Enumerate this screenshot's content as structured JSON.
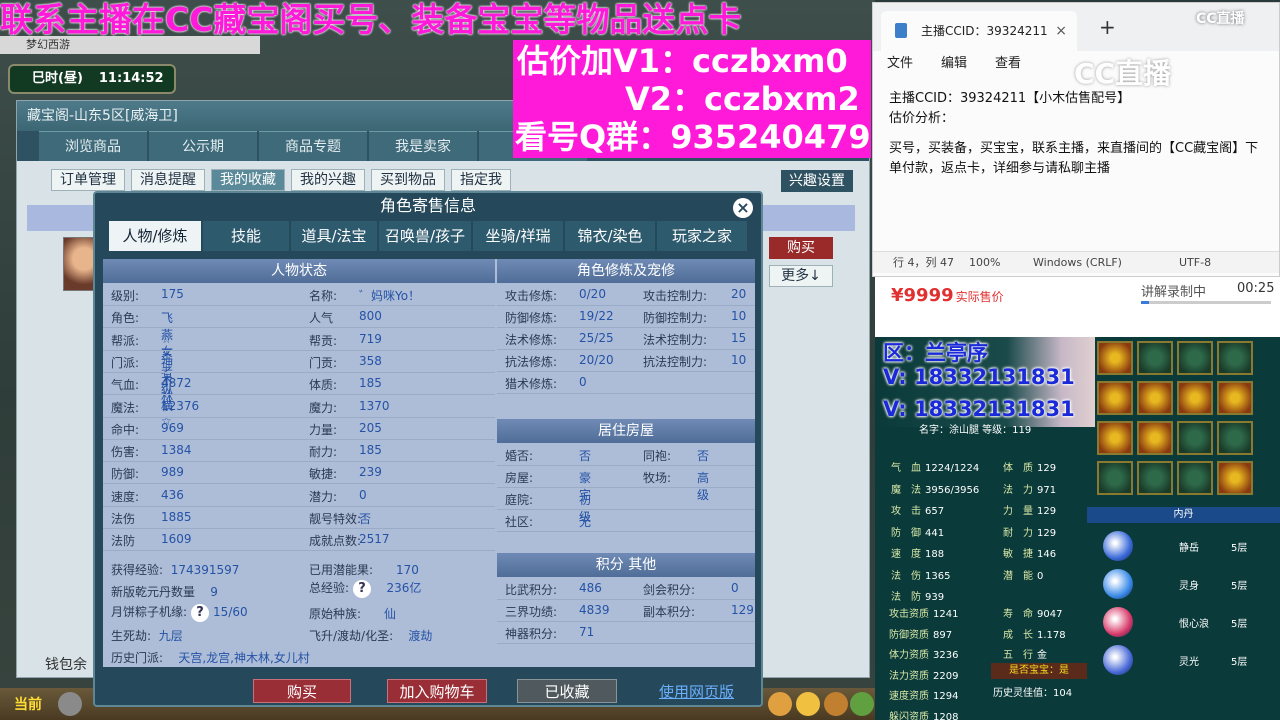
{
  "game": {
    "browser_tab_text": "梦幻西游",
    "clock_label": "巳时(昼)",
    "clock_time": "11:14:52",
    "window_title": "藏宝阁-山东5区[威海卫]",
    "nav_tabs": [
      "浏览商品",
      "公示期",
      "商品专题",
      "我是卖家",
      "我"
    ],
    "sub_tabs": [
      "订单管理",
      "消息提醒",
      "我的收藏",
      "我的兴趣",
      "买到物品",
      "指定我"
    ],
    "interest_settings": "兴趣设置",
    "side_buy": "购买",
    "side_more": "更多↓",
    "wallet_label": "钱包余",
    "current_label": "当前"
  },
  "dialog": {
    "title": "角色寄售信息",
    "close": "×",
    "tabs": [
      "人物/修炼",
      "技能",
      "道具/法宝",
      "召唤兽/孩子",
      "坐骑/祥瑞",
      "锦衣/染色",
      "玩家之家"
    ],
    "status_head": "人物状态",
    "status_left": [
      {
        "k": "级别:",
        "v": "175"
      },
      {
        "k": "角色:",
        "v": "飞燕女"
      },
      {
        "k": "帮派:",
        "v": "☆王者纵横☆"
      },
      {
        "k": "门派:",
        "v": "神木林"
      },
      {
        "k": "气血:",
        "v": "4872"
      },
      {
        "k": "魔法:",
        "v": "12376"
      },
      {
        "k": "命中:",
        "v": "969"
      },
      {
        "k": "伤害:",
        "v": "1384"
      },
      {
        "k": "防御:",
        "v": "989"
      },
      {
        "k": "速度:",
        "v": "436"
      },
      {
        "k": "法伤",
        "v": "1885"
      },
      {
        "k": "法防",
        "v": "1609"
      }
    ],
    "status_right": [
      {
        "k": "名称:",
        "v": "゛妈咪Yo！"
      },
      {
        "k": "人气",
        "v": "800"
      },
      {
        "k": "帮贡:",
        "v": "719"
      },
      {
        "k": "门贡:",
        "v": "358"
      },
      {
        "k": "体质:",
        "v": "185"
      },
      {
        "k": "魔力:",
        "v": "1370"
      },
      {
        "k": "力量:",
        "v": "205"
      },
      {
        "k": "耐力:",
        "v": "185"
      },
      {
        "k": "敏捷:",
        "v": "239"
      },
      {
        "k": "潜力:",
        "v": "0"
      },
      {
        "k": "靓号特效:",
        "v": "否"
      },
      {
        "k": "成就点数:",
        "v": "2517"
      }
    ],
    "exp_label": "获得经验:",
    "exp_value": "174391597",
    "potential_label": "已用潜能果:",
    "potential_value": "170",
    "dan_label": "新版乾元丹数量",
    "dan_value": "9",
    "total_exp_label": "总经验:",
    "total_exp_value": "236亿",
    "zongzi_label": "月饼粽子机缘:",
    "zongzi_value": "15/60",
    "race_label": "原始种族:",
    "race_value": "仙",
    "life_label": "生死劫:",
    "life_value": "九层",
    "fly_label": "飞升/渡劫/化圣:",
    "fly_value": "渡劫",
    "history_label": "历史门派:",
    "history_value": "天宫,龙宫,神木林,女儿村",
    "cultivation_head": "角色修炼及宠修",
    "cultivation": [
      {
        "k": "攻击修炼:",
        "v": "0/20",
        "k2": "攻击控制力:",
        "v2": "20"
      },
      {
        "k": "防御修炼:",
        "v": "19/22",
        "k2": "防御控制力:",
        "v2": "10"
      },
      {
        "k": "法术修炼:",
        "v": "25/25",
        "k2": "法术控制力:",
        "v2": "15"
      },
      {
        "k": "抗法修炼:",
        "v": "20/20",
        "k2": "抗法控制力:",
        "v2": "10"
      },
      {
        "k": "猎术修炼:",
        "v": "0",
        "k2": "",
        "v2": ""
      }
    ],
    "house_head": "居住房屋",
    "house": [
      {
        "k": "婚否:",
        "v": "否",
        "k2": "同袍:",
        "v2": "否"
      },
      {
        "k": "房屋:",
        "v": "豪宅",
        "k2": "牧场:",
        "v2": "高级"
      },
      {
        "k": "庭院:",
        "v": "初级",
        "k2": "",
        "v2": ""
      },
      {
        "k": "社区:",
        "v": "无",
        "k2": "",
        "v2": ""
      }
    ],
    "score_head": "积分 其他",
    "score": [
      {
        "k": "比武积分:",
        "v": "486",
        "k2": "剑会积分:",
        "v2": "0"
      },
      {
        "k": "三界功绩:",
        "v": "4839",
        "k2": "副本积分:",
        "v2": "129"
      },
      {
        "k": "神器积分:",
        "v": "71",
        "k2": "",
        "v2": ""
      }
    ],
    "btn_buy": "购买",
    "btn_cart": "加入购物车",
    "btn_collected": "已收藏",
    "link_web": "使用网页版"
  },
  "overlay": {
    "banner": "联系主播在CC藏宝阁买号、装备宝宝等物品送点卡",
    "price_line1": "估价加V1：cczbxm0",
    "price_line2": "V2：cczbxm2",
    "price_line3": "看号Q群：935240479"
  },
  "notepad": {
    "tab_title": "主播CCID：39324211",
    "tab_close": "×",
    "tab_add": "+",
    "menu": [
      "文件",
      "编辑",
      "查看"
    ],
    "line1": "主播CCID：39324211【小木估售配号】",
    "line2": "估价分析：",
    "line3": "买号，买装备，买宝宝，联系主播，来直播间的【CC藏宝阁】下单付款，返点卡，详细参与请私聊主播",
    "status_pos": "行 4，列 47",
    "status_zoom": "100%",
    "status_eol": "Windows (CRLF)",
    "status_enc": "UTF-8",
    "watermark": "CC直播",
    "logo_top": "CC直播"
  },
  "price_bar": {
    "price": "¥9999",
    "price_note": "实际售价",
    "rec_label": "讲解录制中",
    "rec_time": "00:25",
    "rec_progress": 0.06
  },
  "char_panel": {
    "zone_text": "区：兰亭序",
    "v_line1": "V: 18332131831",
    "v_line2": "V: 18332131831",
    "name_row": "名字：涂山腿  等级：119",
    "stats_left": [
      {
        "k": "气　血",
        "v": "1224/1224"
      },
      {
        "k": "魔　法",
        "v": "3956/3956"
      },
      {
        "k": "攻　击",
        "v": "657"
      },
      {
        "k": "防　御",
        "v": "441"
      },
      {
        "k": "速　度",
        "v": "188"
      },
      {
        "k": "法　伤",
        "v": "1365"
      },
      {
        "k": "法　防",
        "v": "939"
      }
    ],
    "stats_mid": [
      {
        "k": "体　质",
        "v": "129"
      },
      {
        "k": "法　力",
        "v": "971"
      },
      {
        "k": "力　量",
        "v": "129"
      },
      {
        "k": "耐　力",
        "v": "129"
      },
      {
        "k": "敏　捷",
        "v": "146"
      },
      {
        "k": "潜　能",
        "v": "0"
      }
    ],
    "stats_bottom_left": [
      {
        "k": "攻击资质",
        "v": "1241"
      },
      {
        "k": "防御资质",
        "v": "897"
      },
      {
        "k": "体力资质",
        "v": "3236"
      },
      {
        "k": "法力资质",
        "v": "2209"
      },
      {
        "k": "速度资质",
        "v": "1294"
      },
      {
        "k": "躲闪资质",
        "v": "1208"
      }
    ],
    "stats_bottom_mid": [
      {
        "k": "寿　命",
        "v": "9047"
      },
      {
        "k": "成　长",
        "v": "1.178"
      },
      {
        "k": "五　行",
        "v": "金"
      }
    ],
    "treasure": "是否宝宝：是",
    "history_dye": "历史灵佳值：104",
    "neidan_head": "内丹",
    "neidan": [
      {
        "name": "静岳",
        "lvl": "5层",
        "color": "#3a6ad8"
      },
      {
        "name": "灵身",
        "lvl": "5层",
        "color": "#3a8ae8"
      },
      {
        "name": "恨心浪",
        "lvl": "5层",
        "color": "#d83a6a"
      },
      {
        "name": "灵光",
        "lvl": "5层",
        "color": "#4a6ad8"
      }
    ]
  }
}
